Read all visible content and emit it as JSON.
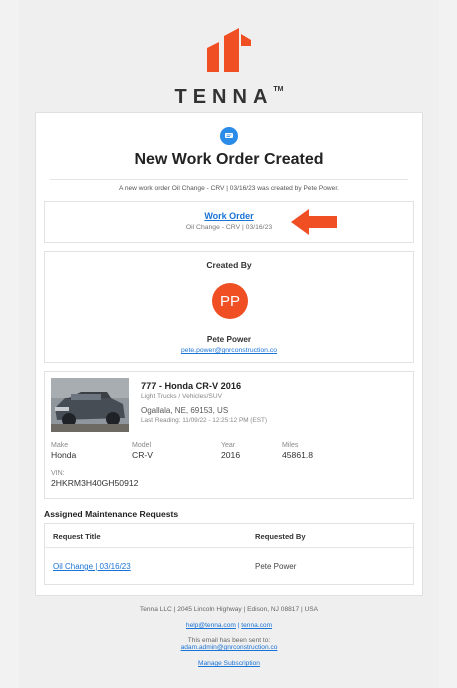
{
  "brand": {
    "name": "TENNA",
    "tm": "TM"
  },
  "header": {
    "title": "New Work Order Created",
    "intro": "A new work order Oil Change - CRV | 03/16/23 was created by Pete Power."
  },
  "work_order": {
    "link_label": "Work Order",
    "subtitle": "Oil Change - CRV | 03/16/23"
  },
  "created_by": {
    "label": "Created By",
    "initials": "PP",
    "name": "Pete Power",
    "email": "pete.power@gnrconstruction.co"
  },
  "asset": {
    "name": "777 - Honda CR-V 2016",
    "category": "Light Trucks / Vehicles/SUV",
    "location": "Ogallala, NE, 69153, US",
    "last_reading": "Last Reading: 11/09/22 - 12:25:12 PM (EST)",
    "make_label": "Make",
    "make": "Honda",
    "model_label": "Model",
    "model": "CR-V",
    "year_label": "Year",
    "year": "2016",
    "miles_label": "Miles",
    "miles": "45861.8",
    "vin_label": "VIN:",
    "vin": "2HKRM3H40GH50912"
  },
  "maintenance": {
    "title": "Assigned Maintenance Requests",
    "col_title": "Request Title",
    "col_requested": "Requested By",
    "rows": [
      {
        "title": "Oil Change | 03/16/23",
        "requested_by": "Pete Power"
      }
    ]
  },
  "footer": {
    "address": "Tenna LLC | 2045 Lincoln Highway | Edison, NJ 08817 | USA",
    "help_email": "help@tenna.com",
    "separator": "|",
    "site": "tenna.com",
    "sent_to_label": "This email has been sent to:",
    "sent_to": "adam.admin@gnrconstruction.co",
    "manage": "Manage Subscription"
  },
  "colors": {
    "accent": "#f04e23",
    "link": "#1a73d6",
    "badge": "#2b8be8"
  }
}
